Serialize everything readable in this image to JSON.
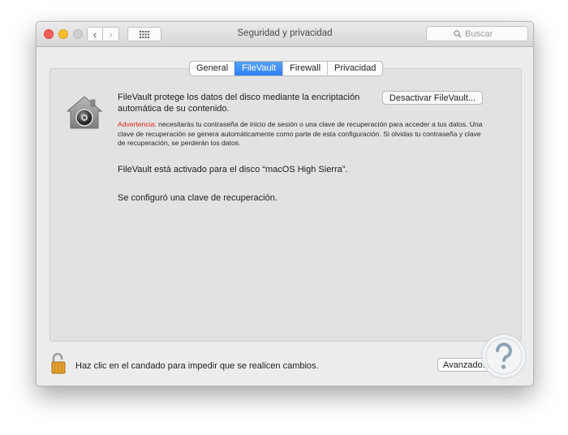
{
  "window": {
    "title": "Seguridad y privacidad",
    "search_placeholder": "Buscar"
  },
  "tabs": [
    {
      "label": "General",
      "active": false
    },
    {
      "label": "FileVault",
      "active": true
    },
    {
      "label": "Firewall",
      "active": false
    },
    {
      "label": "Privacidad",
      "active": false
    }
  ],
  "filevault": {
    "description": "FileVault protege los datos del disco mediante la encriptación automática de su contenido.",
    "deactivate_button": "Desactivar FileVault...",
    "warning_label": "Advertencia:",
    "warning_text": " necesitarás tu contraseña de inicio de sesión o una clave de recuperación para acceder a tus datos. Una clave de recuperación se genera automáticamente como parte de esta configuración. Si olvidas tu contraseña y clave de recuperación, se perderán los datos.",
    "status_disk": "FileVault está activado para el disco “macOS High Sierra”.",
    "status_recovery": "Se configuró una clave de recuperación."
  },
  "footer": {
    "lock_text": "Haz clic en el candado para impedir que se realicen cambios.",
    "advanced_button": "Avanzado..."
  },
  "colors": {
    "accent": "#2c7ff5",
    "warning": "#e0241a",
    "close": "#fc5f57",
    "minimize": "#fdbc2e"
  },
  "icons": [
    "back-chevron-icon",
    "forward-chevron-icon",
    "grid-icon",
    "search-icon",
    "filevault-house-icon",
    "unlocked-padlock-icon",
    "watermark-logo-icon"
  ]
}
